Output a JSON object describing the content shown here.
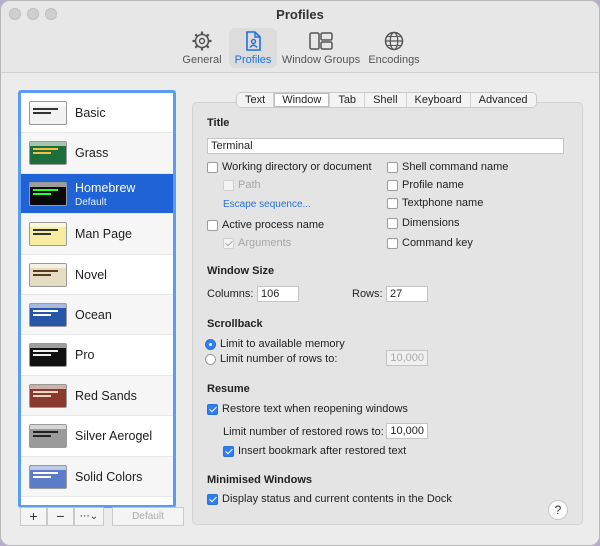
{
  "window": {
    "title": "Profiles"
  },
  "toolbar": [
    {
      "label": "General",
      "icon": "gear-icon",
      "active": false
    },
    {
      "label": "Profiles",
      "icon": "profile-document-icon",
      "active": true
    },
    {
      "label": "Window Groups",
      "icon": "window-groups-icon",
      "active": false
    },
    {
      "label": "Encodings",
      "icon": "globe-icon",
      "active": false
    }
  ],
  "profiles": [
    {
      "name": "Basic",
      "bg": "#f2f2f2",
      "fg": "#333333"
    },
    {
      "name": "Grass",
      "bg": "#1c6e3a",
      "fg": "#f5c04a"
    },
    {
      "name": "Homebrew",
      "sub": "Default",
      "bg": "#0a0a0a",
      "fg": "#28ff28",
      "selected": true
    },
    {
      "name": "Man Page",
      "bg": "#f7eba0",
      "fg": "#333333"
    },
    {
      "name": "Novel",
      "bg": "#e6dcc4",
      "fg": "#5a3b1c"
    },
    {
      "name": "Ocean",
      "bg": "#2656a8",
      "fg": "#ffffff"
    },
    {
      "name": "Pro",
      "bg": "#111111",
      "fg": "#f0f0f0"
    },
    {
      "name": "Red Sands",
      "bg": "#8a3a2c",
      "fg": "#e8d8c0"
    },
    {
      "name": "Silver Aerogel",
      "bg": "#9a9a9a",
      "fg": "#222222"
    },
    {
      "name": "Solid Colors",
      "bg": "#5b7cc7",
      "fg": "#ffffff"
    }
  ],
  "list_buttons": {
    "add": "+",
    "remove": "−",
    "more": "⋯",
    "default": "Default"
  },
  "tabs": [
    "Text",
    "Window",
    "Tab",
    "Shell",
    "Keyboard",
    "Advanced"
  ],
  "active_tab": "Window",
  "title_section": {
    "heading": "Title",
    "value": "Terminal",
    "options_left": [
      {
        "label": "Working directory or document",
        "checked": false,
        "disabled": false
      },
      {
        "label": "Path",
        "checked": false,
        "disabled": true
      },
      {
        "label": "Active process name",
        "checked": false,
        "disabled": false
      },
      {
        "label": "Arguments",
        "checked": true,
        "disabled": true
      }
    ],
    "escape_link": "Escape sequence...",
    "options_right": [
      {
        "label": "Shell command name",
        "checked": false
      },
      {
        "label": "Profile name",
        "checked": false
      },
      {
        "label": "Textphone name",
        "checked": false
      },
      {
        "label": "Dimensions",
        "checked": false
      },
      {
        "label": "Command key",
        "checked": false
      }
    ]
  },
  "window_size": {
    "heading": "Window Size",
    "columns_label": "Columns:",
    "columns": "106",
    "rows_label": "Rows:",
    "rows": "27"
  },
  "scrollback": {
    "heading": "Scrollback",
    "opt1": "Limit to available memory",
    "opt2": "Limit number of rows to:",
    "rows_value": "10,000"
  },
  "resume": {
    "heading": "Resume",
    "restore_label": "Restore text when reopening windows",
    "limit_label": "Limit number of restored rows to:",
    "limit_value": "10,000",
    "bookmark_label": "Insert bookmark after restored text"
  },
  "minimised": {
    "heading": "Minimised Windows",
    "display_label": "Display status and current contents in the Dock"
  },
  "help": "?"
}
